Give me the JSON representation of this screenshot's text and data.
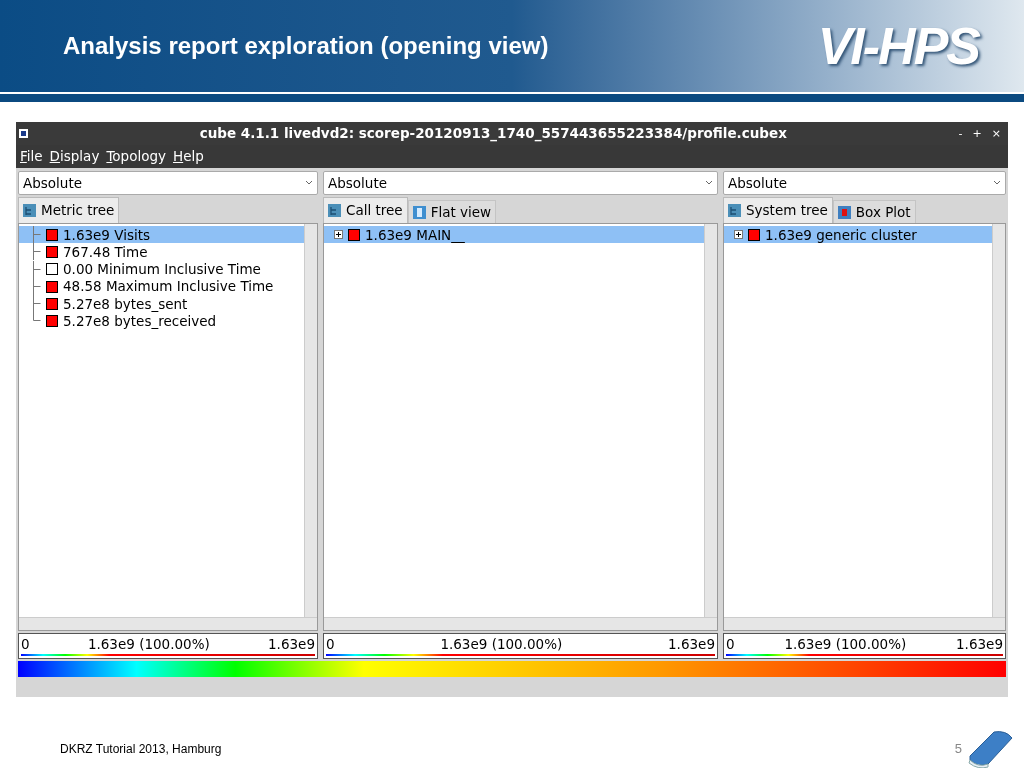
{
  "slide": {
    "title": "Analysis report exploration (opening view)",
    "logo": "VI-HPS",
    "footer": "DKRZ Tutorial 2013, Hamburg",
    "page_number": "5"
  },
  "window": {
    "title": "cube 4.1.1 livedvd2: scorep-20120913_1740_557443655223384/profile.cubex",
    "controls": [
      "-",
      "+",
      "×"
    ]
  },
  "menu": [
    "File",
    "Display",
    "Topology",
    "Help"
  ],
  "panels": [
    {
      "mode": "Absolute",
      "tabs": [
        {
          "label": "Metric tree",
          "kind": "tree",
          "selected": true
        }
      ],
      "items": [
        {
          "kind": "leaf",
          "text": "1.63e9 Visits",
          "color": "#ff0000",
          "selected": true
        },
        {
          "kind": "leaf",
          "text": "767.48 Time",
          "color": "#ff0000",
          "selected": false
        },
        {
          "kind": "leaf",
          "text": "0.00 Minimum Inclusive Time",
          "color": "#ffffff",
          "selected": false
        },
        {
          "kind": "leaf",
          "text": "48.58 Maximum Inclusive Time",
          "color": "#ff0000",
          "selected": false
        },
        {
          "kind": "leaf",
          "text": "5.27e8 bytes_sent",
          "color": "#ff0000",
          "selected": false
        },
        {
          "kind": "last",
          "text": "5.27e8 bytes_received",
          "color": "#ff0000",
          "selected": false
        }
      ],
      "bar": {
        "min": "0",
        "value": "1.63e9 (100.00%)",
        "max": "1.63e9"
      }
    },
    {
      "mode": "Absolute",
      "tabs": [
        {
          "label": "Call tree",
          "kind": "tree",
          "selected": true
        },
        {
          "label": "Flat view",
          "kind": "flat",
          "selected": false
        }
      ],
      "items": [
        {
          "kind": "node",
          "text": "1.63e9 MAIN__",
          "color": "#ff0000",
          "selected": true,
          "expanded": false
        }
      ],
      "bar": {
        "min": "0",
        "value": "1.63e9 (100.00%)",
        "max": "1.63e9"
      }
    },
    {
      "mode": "Absolute",
      "tabs": [
        {
          "label": "System tree",
          "kind": "tree",
          "selected": true
        },
        {
          "label": "Box Plot",
          "kind": "boxplot",
          "selected": false
        }
      ],
      "items": [
        {
          "kind": "node",
          "text": "1.63e9 generic cluster",
          "color": "#ff0000",
          "selected": true,
          "expanded": false
        }
      ],
      "bar": {
        "min": "0",
        "value": "1.63e9 (100.00%)",
        "max": "1.63e9"
      }
    }
  ]
}
